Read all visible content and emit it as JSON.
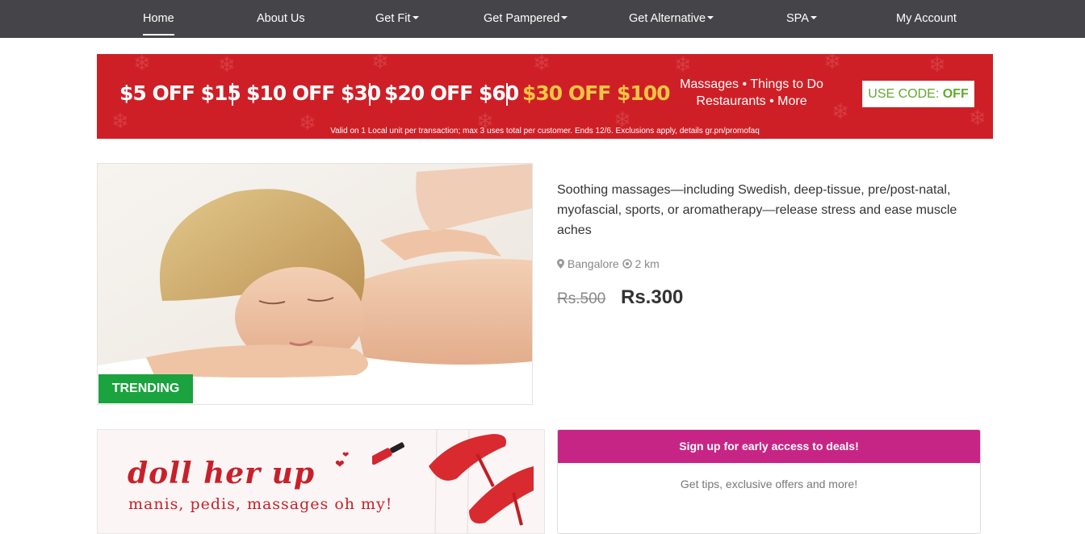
{
  "nav": {
    "home": "Home",
    "about": "About Us",
    "get_fit": "Get Fit",
    "get_pampered": "Get Pampered",
    "get_alternative": "Get Alternative",
    "spa": "SPA",
    "my_account": "My Account"
  },
  "promo": {
    "offer1": "$5 OFF $15",
    "offer2": "$10 OFF $30",
    "offer3": "$20 OFF $60",
    "offer4": "$30 OFF $100",
    "categories_line1": "Massages • Things to Do",
    "categories_line2": "Restaurants • More",
    "code_label": "USE CODE:",
    "code_value": "OFF",
    "fine_print": "Valid on 1 Local unit per transaction; max 3 uses total per customer. Ends 12/6. Exclusions apply, details gr.pn/promofaq"
  },
  "deal": {
    "badge": "TRENDING",
    "description": "Soothing massages—including Swedish, deep-tissue, pre/post-natal, myofascial, sports, or aromatherapy—release stress and ease muscle aches",
    "location": "Bangalore",
    "distance": "2 km",
    "old_price": "Rs.500",
    "new_price": "Rs.300"
  },
  "doll_banner": {
    "title": "doll her up",
    "subtitle": "manis, pedis, massages oh my!"
  },
  "signup": {
    "heading": "Sign up for early access to deals!",
    "subtext": "Get tips, exclusive offers and more!"
  },
  "colors": {
    "nav_bg": "#454549",
    "promo_red": "#cf1f26",
    "promo_gold": "#f6c545",
    "code_green": "#63a830",
    "trending_green": "#1aa33e",
    "signup_magenta": "#c72585"
  }
}
